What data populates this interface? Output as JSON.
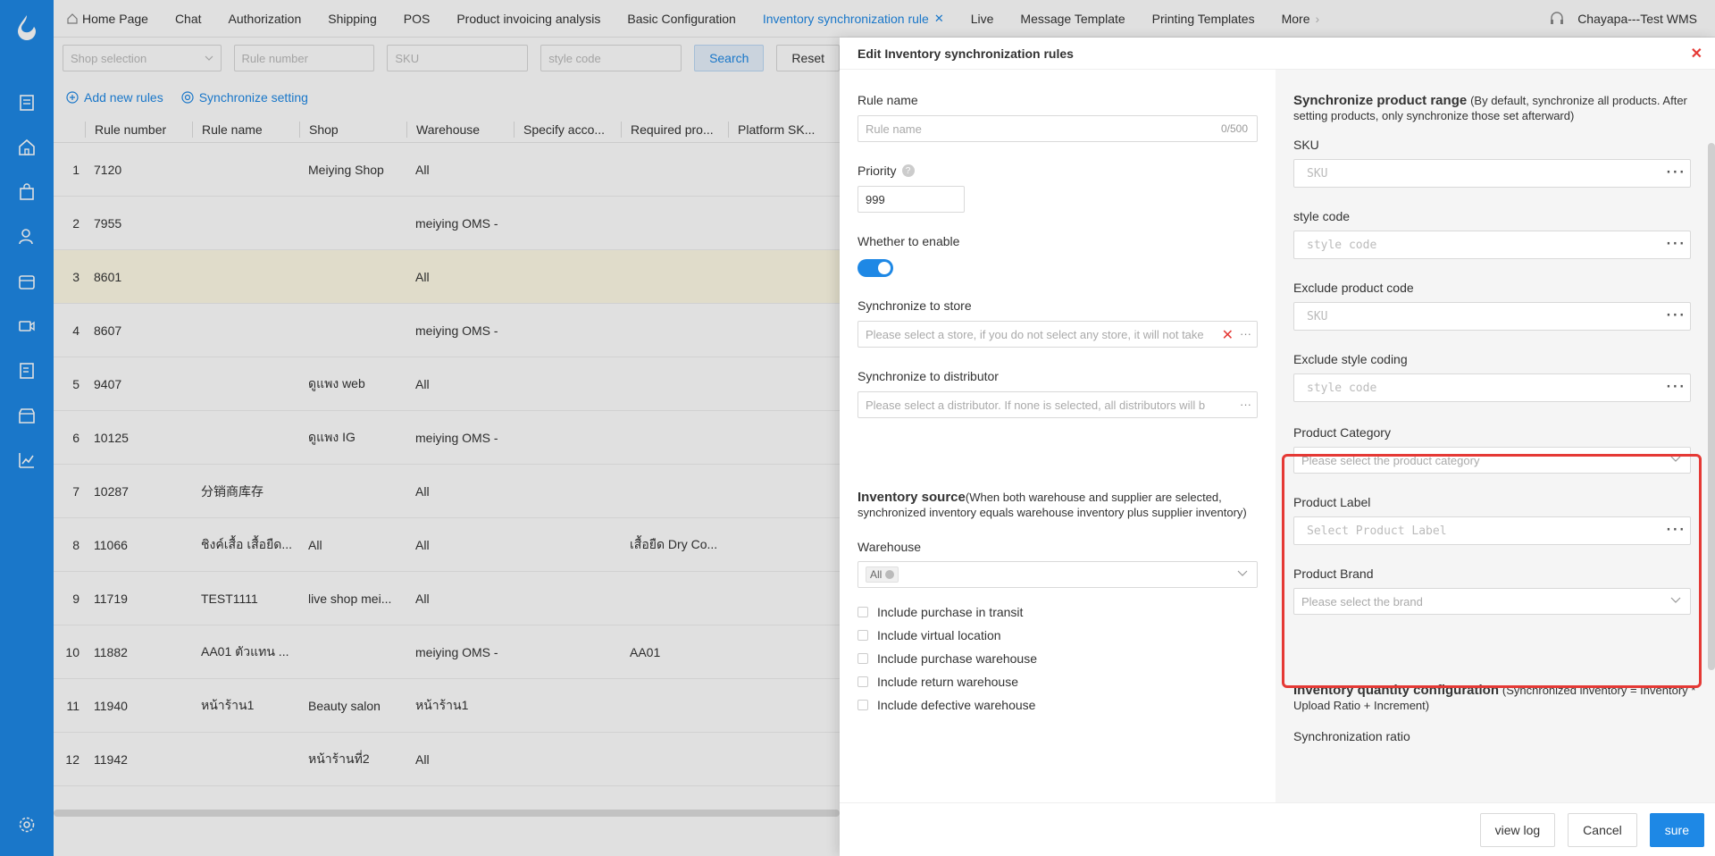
{
  "nav": {
    "tabs": [
      {
        "label": "Home Page"
      },
      {
        "label": "Chat"
      },
      {
        "label": "Authorization"
      },
      {
        "label": "Shipping"
      },
      {
        "label": "POS"
      },
      {
        "label": "Product invoicing analysis"
      },
      {
        "label": "Basic Configuration"
      },
      {
        "label": "Inventory synchronization rule"
      },
      {
        "label": "Live"
      },
      {
        "label": "Message Template"
      },
      {
        "label": "Printing Templates"
      },
      {
        "label": "More"
      }
    ],
    "active_tab_index": 7,
    "user": "Chayapa---Test WMS"
  },
  "filters": {
    "shop_placeholder": "Shop selection",
    "rule_number_placeholder": "Rule number",
    "sku_placeholder": "SKU",
    "style_code_placeholder": "style code",
    "search_label": "Search",
    "reset_label": "Reset"
  },
  "actions": {
    "add_label": "Add new rules",
    "sync_label": "Synchronize setting"
  },
  "table": {
    "columns": [
      "Rule number",
      "Rule name",
      "Shop",
      "Warehouse",
      "Specify acco...",
      "Required pro...",
      "Platform SK..."
    ],
    "rows": [
      {
        "idx": "1",
        "rule_number": "7120",
        "rule_name": "",
        "shop": "Meiying Shop",
        "warehouse": "All",
        "account": "",
        "required": ""
      },
      {
        "idx": "2",
        "rule_number": "7955",
        "rule_name": "",
        "shop": "",
        "warehouse": "meiying OMS -",
        "account": "",
        "required": ""
      },
      {
        "idx": "3",
        "rule_number": "8601",
        "rule_name": "",
        "shop": "",
        "warehouse": "All",
        "account": "",
        "required": ""
      },
      {
        "idx": "4",
        "rule_number": "8607",
        "rule_name": "",
        "shop": "",
        "warehouse": "meiying OMS -",
        "account": "",
        "required": ""
      },
      {
        "idx": "5",
        "rule_number": "9407",
        "rule_name": "",
        "shop": "ดูแพง web",
        "warehouse": "All",
        "account": "",
        "required": ""
      },
      {
        "idx": "6",
        "rule_number": "10125",
        "rule_name": "",
        "shop": "ดูแพง IG",
        "warehouse": "meiying OMS -",
        "account": "",
        "required": ""
      },
      {
        "idx": "7",
        "rule_number": "10287",
        "rule_name": "分销商库存",
        "shop": "",
        "warehouse": "All",
        "account": "",
        "required": ""
      },
      {
        "idx": "8",
        "rule_number": "11066",
        "rule_name": "ชิงค์เสื้อ เสื้อยืด...",
        "shop": "All",
        "warehouse": "All",
        "account": "",
        "required": "เสื้อยืด Dry Co..."
      },
      {
        "idx": "9",
        "rule_number": "11719",
        "rule_name": "TEST1111",
        "shop": "live shop mei...",
        "warehouse": "All",
        "account": "",
        "required": ""
      },
      {
        "idx": "10",
        "rule_number": "11882",
        "rule_name": "AA01 ตัวแทน ...",
        "shop": "",
        "warehouse": "meiying OMS -",
        "account": "",
        "required": "AA01"
      },
      {
        "idx": "11",
        "rule_number": "11940",
        "rule_name": "หน้าร้าน1",
        "shop": "Beauty salon",
        "warehouse": "หน้าร้าน1",
        "account": "",
        "required": ""
      },
      {
        "idx": "12",
        "rule_number": "11942",
        "rule_name": "",
        "shop": "หน้าร้านที่2",
        "warehouse": "All",
        "account": "",
        "required": ""
      }
    ]
  },
  "drawer": {
    "title": "Edit Inventory synchronization rules",
    "rule_name_label": "Rule name",
    "rule_name_placeholder": "Rule name",
    "rule_name_count": "0/500",
    "priority_label": "Priority",
    "priority_value": "999",
    "enable_label": "Whether to enable",
    "enabled": true,
    "store_label": "Synchronize to store",
    "store_placeholder": "Please select a store, if you do not select any store, it will not take",
    "distributor_label": "Synchronize to distributor",
    "distributor_placeholder": "Please select a distributor. If none is selected, all distributors will b",
    "inv_source_title": "Inventory source",
    "inv_source_note": "(When both warehouse and supplier are selected, synchronized inventory equals warehouse inventory plus supplier inventory)",
    "warehouse_label": "Warehouse",
    "warehouse_tag": "All",
    "checkboxes": [
      "Include purchase in transit",
      "Include virtual location",
      "Include purchase warehouse",
      "Include return warehouse",
      "Include defective warehouse"
    ],
    "range_title": "Synchronize product range",
    "range_note": "(By default, synchronize all products. After setting products, only synchronize those set afterward)",
    "sku_label": "SKU",
    "sku_placeholder": "SKU",
    "style_label": "style code",
    "style_placeholder": "style code",
    "exclude_product_label": "Exclude product code",
    "exclude_product_placeholder": "SKU",
    "exclude_style_label": "Exclude style coding",
    "exclude_style_placeholder": "style code",
    "category_label": "Product Category",
    "category_placeholder": "Please select the product category",
    "label_label": "Product Label",
    "label_placeholder": "Select Product Label",
    "brand_label": "Product Brand",
    "brand_placeholder": "Please select the brand",
    "qty_title": "Inventory quantity configuration",
    "qty_note": "(Synchronized inventory = Inventory * Upload Ratio + Increment)",
    "sync_ratio_label": "Synchronization ratio",
    "view_log": "view log",
    "cancel": "Cancel",
    "sure": "sure"
  },
  "colors": {
    "accent": "#1e88e5",
    "highlight_border": "#e53935"
  }
}
